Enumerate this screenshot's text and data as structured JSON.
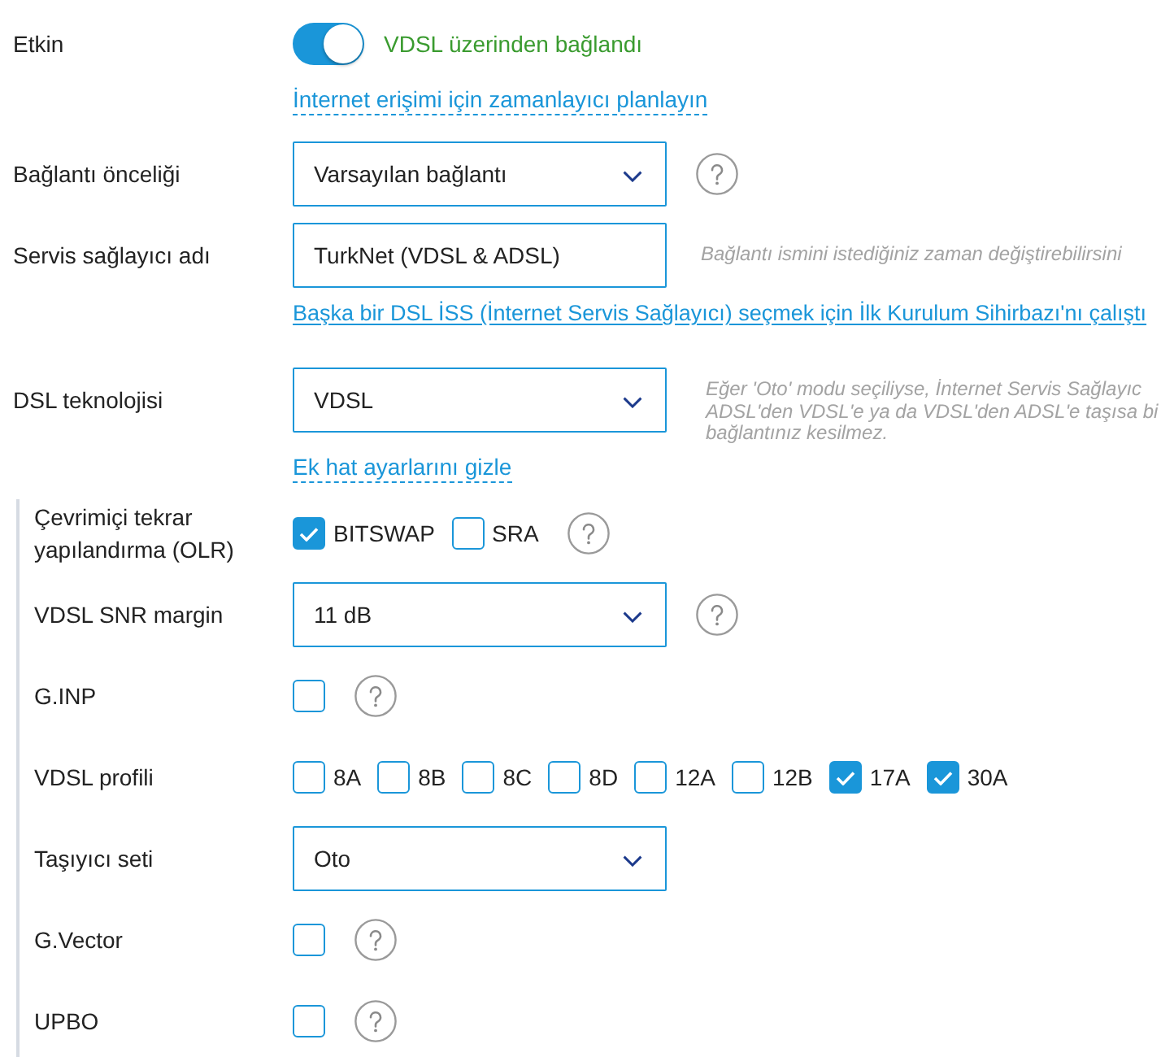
{
  "general": [
    {
      "kind": "toggle",
      "label": "Etkin",
      "on": true,
      "status": "VDSL üzerinden bağlandı"
    },
    {
      "kind": "action_link",
      "text": "İnternet erişimi için zamanlayıcı planlayın"
    },
    {
      "kind": "select",
      "label": "Bağlantı önceliği",
      "value": "Varsayılan bağlantı",
      "help": true
    },
    {
      "kind": "text_input",
      "label": "Servis sağlayıcı adı",
      "value": "TurkNet (VDSL & ADSL)",
      "help": false,
      "hint": [
        "Bağlantı ismini istediğiniz zaman değiştirebilirsini"
      ]
    },
    {
      "kind": "page_link",
      "text": "Başka bir DSL İSS (İnternet Servis Sağlayıcı) seçmek için İlk Kurulum Sihirbazı'nı çalıştı"
    },
    {
      "kind": "select",
      "label": "DSL teknolojisi",
      "value": "VDSL",
      "help": false,
      "hint": [
        "Eğer 'Oto' modu seçiliyse, İnternet Servis Sağlayıc",
        "ADSL'den VDSL'e ya da VDSL'den ADSL'e taşısa bi",
        "bağlantınız kesilmez."
      ]
    },
    {
      "kind": "action_link",
      "text": "Ek hat ayarlarını gizle"
    }
  ],
  "advanced": [
    {
      "kind": "checkboxes",
      "label": "Çevrimiçi tekrar yapılandırma (OLR)",
      "help": true,
      "options": [
        {
          "label": "BITSWAP",
          "checked": true
        },
        {
          "label": "SRA",
          "checked": false
        }
      ]
    },
    {
      "kind": "select",
      "label": "VDSL SNR margin",
      "value": "11 dB",
      "help": true
    },
    {
      "kind": "checkboxes",
      "label": "G.INP",
      "help": true,
      "options": [
        {
          "checked": false
        }
      ]
    },
    {
      "kind": "checkboxes",
      "label": "VDSL profili",
      "help": false,
      "options": [
        {
          "label": "8A",
          "checked": false
        },
        {
          "label": "8B",
          "checked": false
        },
        {
          "label": "8C",
          "checked": false
        },
        {
          "label": "8D",
          "checked": false
        },
        {
          "label": "12A",
          "checked": false
        },
        {
          "label": "12B",
          "checked": false
        },
        {
          "label": "17A",
          "checked": true
        },
        {
          "label": "30A",
          "checked": true
        }
      ]
    },
    {
      "kind": "select",
      "label": "Taşıyıcı seti",
      "value": "Oto",
      "help": false
    },
    {
      "kind": "checkboxes",
      "label": "G.Vector",
      "help": true,
      "options": [
        {
          "checked": false
        }
      ]
    },
    {
      "kind": "checkboxes",
      "label": "UPBO",
      "help": true,
      "options": [
        {
          "checked": false
        }
      ]
    }
  ]
}
